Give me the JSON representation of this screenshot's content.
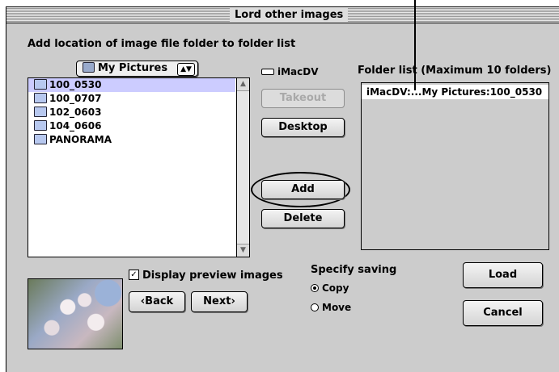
{
  "window": {
    "title": "Lord other images"
  },
  "instructions": "Add location of image file folder to folder list",
  "location_popup": {
    "value": "My Pictures",
    "icon": "camera-folder-icon"
  },
  "disk": {
    "label": "iMacDV",
    "icon": "disk-icon"
  },
  "file_list": {
    "items": [
      {
        "label": "100_0530",
        "selected": true
      },
      {
        "label": "100_0707",
        "selected": false
      },
      {
        "label": "102_0603",
        "selected": false
      },
      {
        "label": "104_0606",
        "selected": false
      },
      {
        "label": "PANORAMA",
        "selected": false
      }
    ]
  },
  "buttons": {
    "takeout": "Takeout",
    "desktop": "Desktop",
    "add": "Add",
    "delete": "Delete",
    "back": "‹Back",
    "next": "Next›",
    "load": "Load",
    "cancel": "Cancel"
  },
  "folder_list": {
    "label": "Folder list (Maximum 10 folders)",
    "items": [
      "iMacDV:...My Pictures:100_0530"
    ]
  },
  "preview": {
    "checkbox_label": "Display preview images",
    "checked": true
  },
  "saving": {
    "label": "Specify saving",
    "options": [
      {
        "label": "Copy",
        "selected": true
      },
      {
        "label": "Move",
        "selected": false
      }
    ]
  },
  "colors": {
    "window_bg": "#cccccc",
    "selection": "#ccccff"
  }
}
